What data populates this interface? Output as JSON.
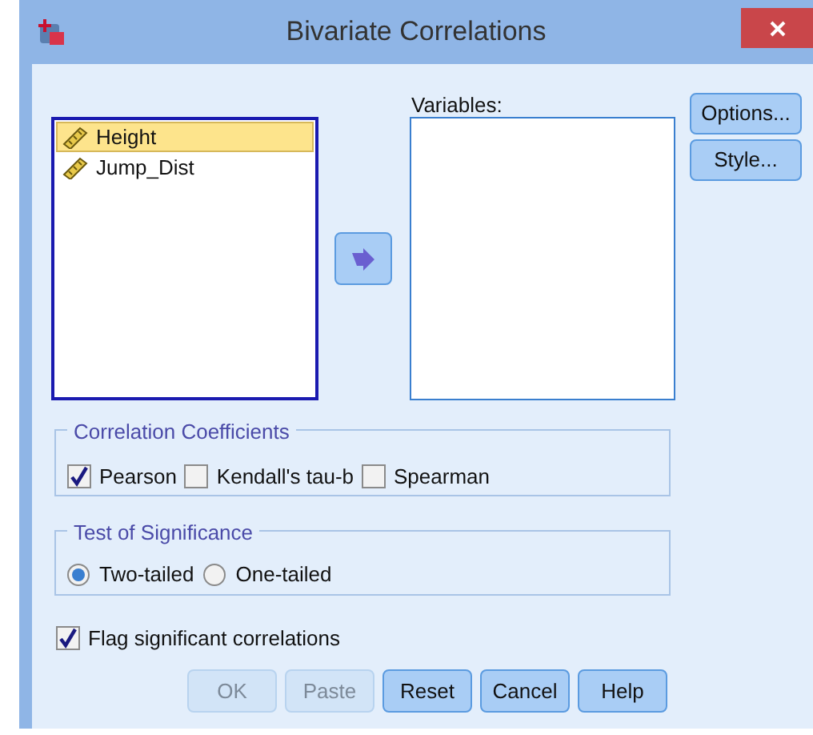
{
  "window": {
    "title": "Bivariate Correlations"
  },
  "source_list": {
    "items": [
      {
        "label": "Height",
        "selected": true
      },
      {
        "label": "Jump_Dist",
        "selected": false
      }
    ]
  },
  "variables": {
    "label": "Variables:"
  },
  "side_buttons": [
    {
      "label": "Options..."
    },
    {
      "label": "Style..."
    }
  ],
  "correlation_coefficients": {
    "title": "Correlation Coefficients",
    "options": [
      {
        "label": "Pearson",
        "checked": true
      },
      {
        "label": "Kendall's tau-b",
        "checked": false
      },
      {
        "label": "Spearman",
        "checked": false
      }
    ]
  },
  "test_of_significance": {
    "title": "Test of Significance",
    "options": [
      {
        "label": "Two-tailed",
        "selected": true
      },
      {
        "label": "One-tailed",
        "selected": false
      }
    ]
  },
  "flag": {
    "label": "Flag significant correlations",
    "checked": true
  },
  "buttons": [
    {
      "label": "OK",
      "disabled": true
    },
    {
      "label": "Paste",
      "disabled": true
    },
    {
      "label": "Reset",
      "disabled": false
    },
    {
      "label": "Cancel",
      "disabled": false
    },
    {
      "label": "Help",
      "disabled": false
    }
  ]
}
